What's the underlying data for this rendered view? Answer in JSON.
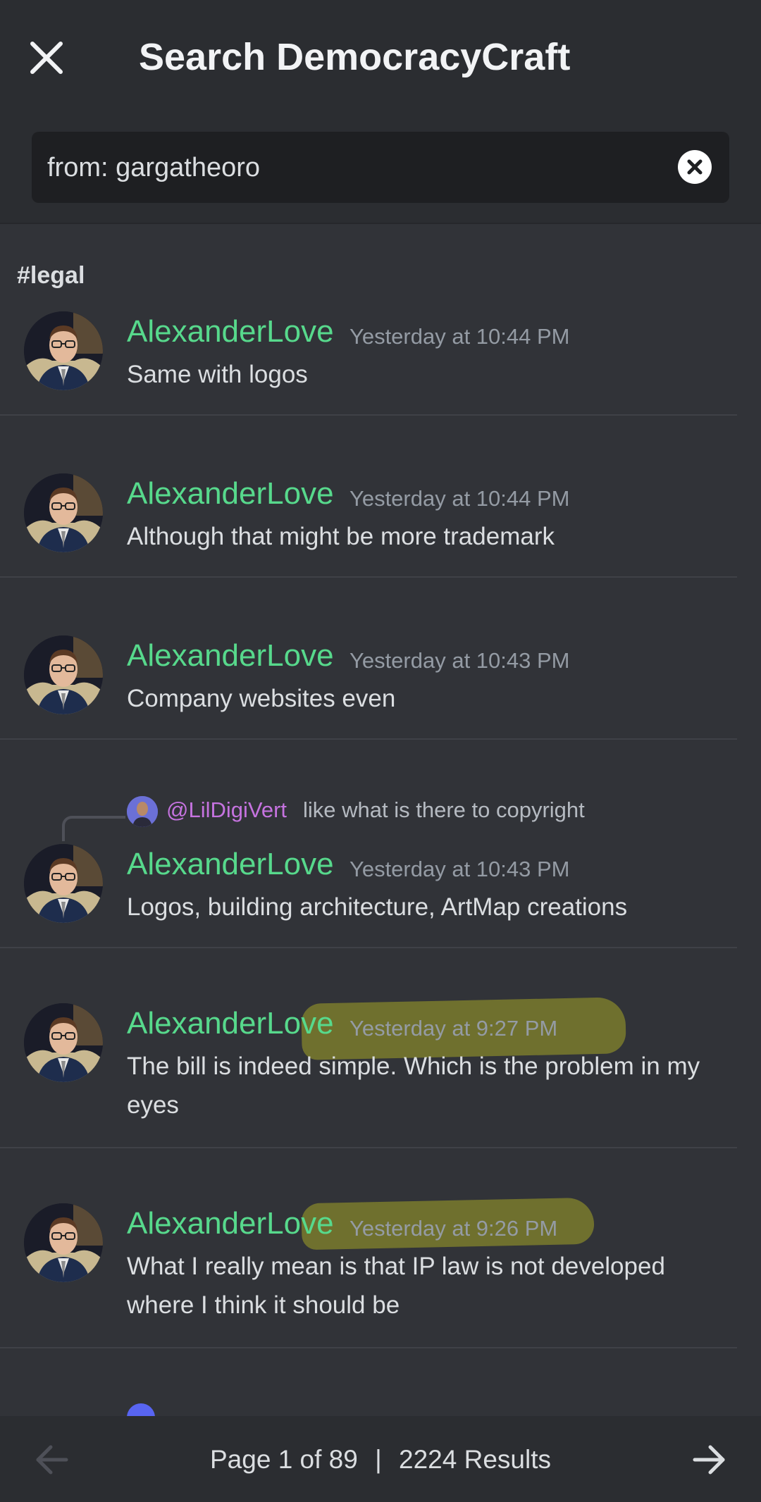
{
  "header": {
    "title": "Search DemocracyCraft",
    "search_value": "from: gargatheoro"
  },
  "channel": "#legal",
  "results": [
    {
      "author": "AlexanderLove",
      "timestamp": "Yesterday at 10:44 PM",
      "message": "Same with logos"
    },
    {
      "author": "AlexanderLove",
      "timestamp": "Yesterday at 10:44 PM",
      "message": "Although that might be more trademark"
    },
    {
      "author": "AlexanderLove",
      "timestamp": "Yesterday at 10:43 PM",
      "message": "Company websites even"
    },
    {
      "author": "AlexanderLove",
      "timestamp": "Yesterday at 10:43 PM",
      "message": "Logos, building architecture, ArtMap creations",
      "reply": {
        "mention": "@LilDigiVert",
        "text": "like what is there to copyright"
      }
    },
    {
      "author": "AlexanderLove",
      "timestamp": "Yesterday at 9:27 PM",
      "message": "The bill is indeed simple. Which is the problem in my eyes",
      "highlighted": true
    },
    {
      "author": "AlexanderLove",
      "timestamp": "Yesterday at 9:26 PM",
      "message": "What I really mean is that IP law is not developed where I think it should be",
      "highlighted": true
    }
  ],
  "footer": {
    "page_label": "Page 1 of 89",
    "separator": "|",
    "results_label": "2224 Results"
  },
  "colors": {
    "author": "#57d98c",
    "mention": "#c573df",
    "highlight": "#96962a",
    "background": "#313338"
  },
  "icons": {
    "close": "close-icon",
    "clear": "clear-x-icon",
    "prev": "arrow-left-icon",
    "next": "arrow-right-icon"
  }
}
